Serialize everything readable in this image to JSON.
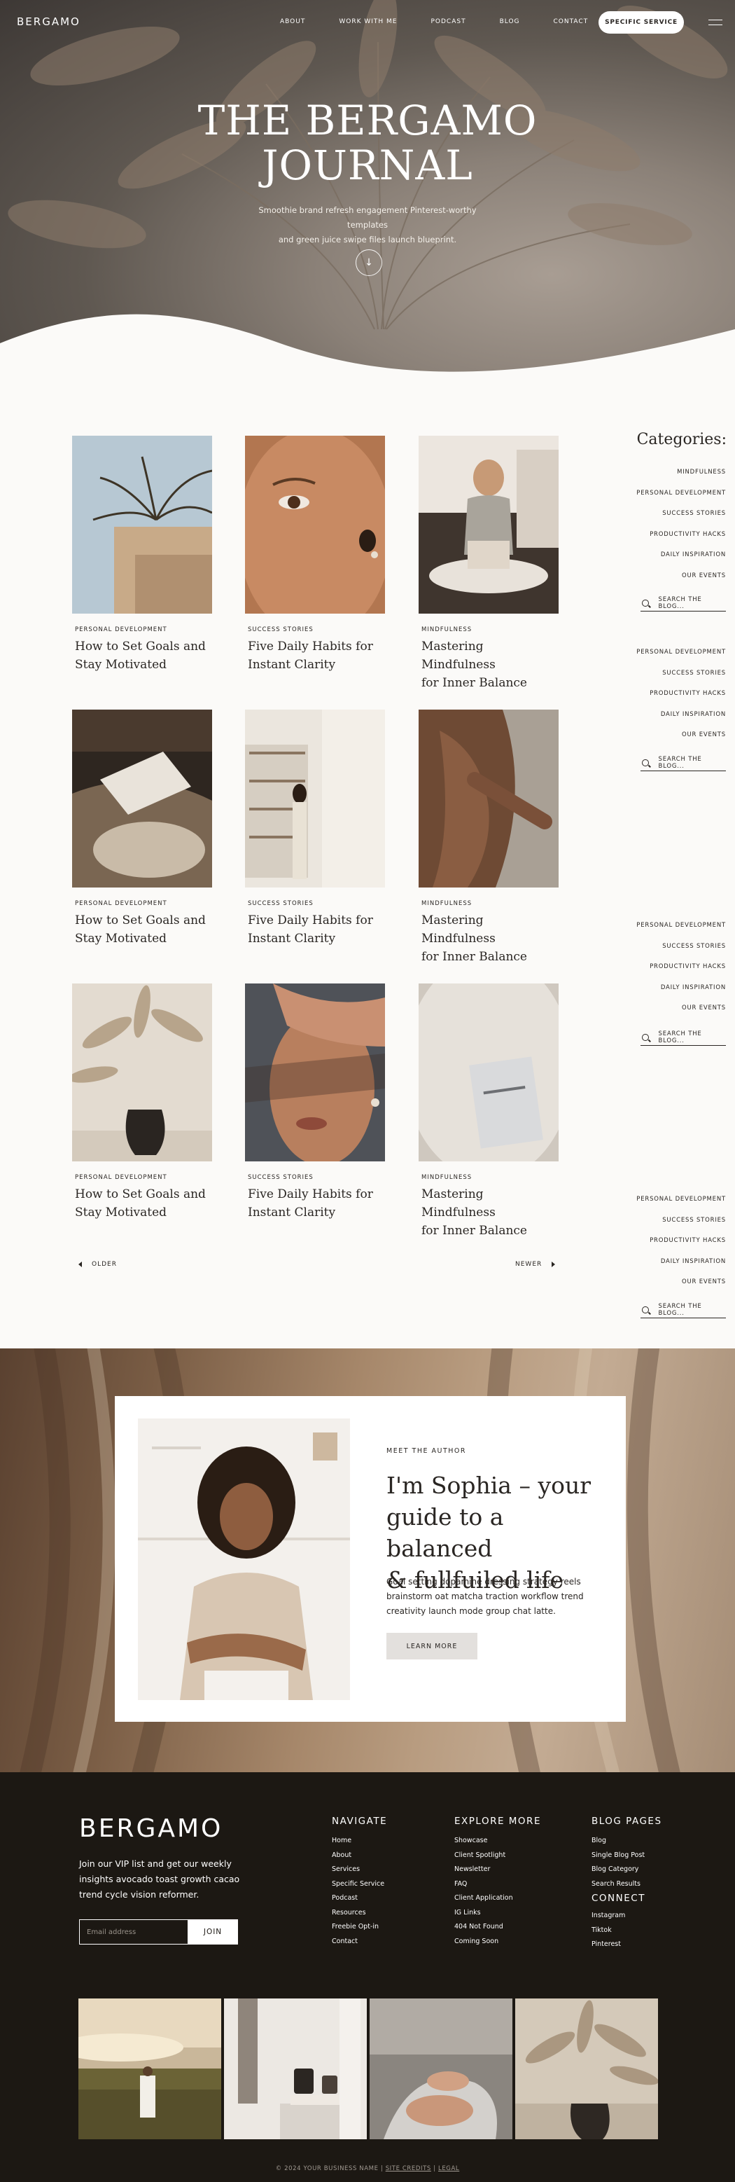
{
  "nav": {
    "logo": "BERGAMO",
    "links": [
      "ABOUT",
      "WORK WITH ME",
      "PODCAST",
      "BLOG",
      "CONTACT"
    ],
    "cta": "SPECIFIC SERVICE"
  },
  "hero": {
    "title_line1": "THE BERGAMO",
    "title_line2": "JOURNAL",
    "subtitle_line1": "Smoothie brand refresh engagement Pinterest-worthy templates",
    "subtitle_line2": "and green juice swipe files launch blueprint.",
    "scroll_icon": "↓"
  },
  "posts": [
    {
      "category": "PERSONAL DEVELOPMENT",
      "title_line1": "How to Set Goals and",
      "title_line2": "Stay Motivated",
      "image": "palm-on-rooftop"
    },
    {
      "category": "SUCCESS STORIES",
      "title_line1": "Five Daily Habits for",
      "title_line2": "Instant Clarity",
      "image": "freckled-face-closeup"
    },
    {
      "category": "MINDFULNESS",
      "title_line1": "Mastering Mindfulness",
      "title_line2": "for Inner Balance",
      "image": "woman-reading-on-floor"
    },
    {
      "category": "PERSONAL DEVELOPMENT",
      "title_line1": "How to Set Goals and",
      "title_line2": "Stay Motivated",
      "image": "reading-magazine"
    },
    {
      "category": "SUCCESS STORIES",
      "title_line1": "Five Daily Habits for",
      "title_line2": "Instant Clarity",
      "image": "woman-at-bookshelf"
    },
    {
      "category": "MINDFULNESS",
      "title_line1": "Mastering Mindfulness",
      "title_line2": "for Inner Balance",
      "image": "shoulder-closeup"
    },
    {
      "category": "PERSONAL DEVELOPMENT",
      "title_line1": "How to Set Goals and",
      "title_line2": "Stay Motivated",
      "image": "pampas-vase"
    },
    {
      "category": "SUCCESS STORIES",
      "title_line1": "Five Daily Habits for",
      "title_line2": "Instant Clarity",
      "image": "hand-shadow-face"
    },
    {
      "category": "MINDFULNESS",
      "title_line1": "Mastering Mindfulness",
      "title_line2": "for Inner Balance",
      "image": "journal-on-knit"
    }
  ],
  "sidebar": {
    "title": "Categories:",
    "first_group": [
      "MINDFULNESS",
      "PERSONAL DEVELOPMENT",
      "SUCCESS STORIES",
      "PRODUCTIVITY HACKS",
      "DAILY INSPIRATION",
      "OUR EVENTS"
    ],
    "group": [
      "PERSONAL DEVELOPMENT",
      "SUCCESS STORIES",
      "PRODUCTIVITY HACKS",
      "DAILY INSPIRATION",
      "OUR EVENTS"
    ],
    "search_placeholder": "SEARCH THE BLOG..."
  },
  "pagination": {
    "older": "OLDER",
    "newer": "NEWER"
  },
  "author": {
    "eyebrow": "MEET THE AUTHOR",
    "heading_line1": "I'm Sophia – your",
    "heading_line2": "guide to a balanced",
    "heading_line3": "& fullfuiled life",
    "body": "Goal setting dopamine dressing strategy reels brainstorm oat matcha traction workflow trend creativity launch mode group chat latte.",
    "button": "LEARN MORE"
  },
  "footer": {
    "logo": "BERGAMO",
    "blurb": "Join our VIP list and get our weekly insights avocado toast growth cacao trend cycle vision reformer.",
    "email_placeholder": "Email address",
    "join": "JOIN",
    "navigate": {
      "heading": "NAVIGATE",
      "links": [
        "Home",
        "About",
        "Services",
        "Specific Service",
        "Podcast",
        "Resources",
        "Freebie Opt-in",
        "Contact"
      ]
    },
    "explore": {
      "heading": "EXPLORE MORE",
      "links": [
        "Showcase",
        "Client Spotlight",
        "Newsletter",
        "FAQ",
        "Client Application",
        "IG Links",
        "404 Not Found",
        "Coming Soon"
      ]
    },
    "blog_pages": {
      "heading": "BLOG PAGES",
      "links": [
        "Blog",
        "Single Blog Post",
        "Blog Category",
        "Search Results"
      ]
    },
    "connect": {
      "heading": "CONNECT",
      "links": [
        "Instagram",
        "Tiktok",
        "Pinterest"
      ]
    },
    "copyright": "© 2024 YOUR BUSINESS NAME",
    "site_credits": "SITE CREDITS",
    "legal": "LEGAL",
    "separator": "|"
  },
  "colors": {
    "dark": "#1c1813",
    "text": "#2a2623",
    "page_bg": "#fbfaf8"
  }
}
